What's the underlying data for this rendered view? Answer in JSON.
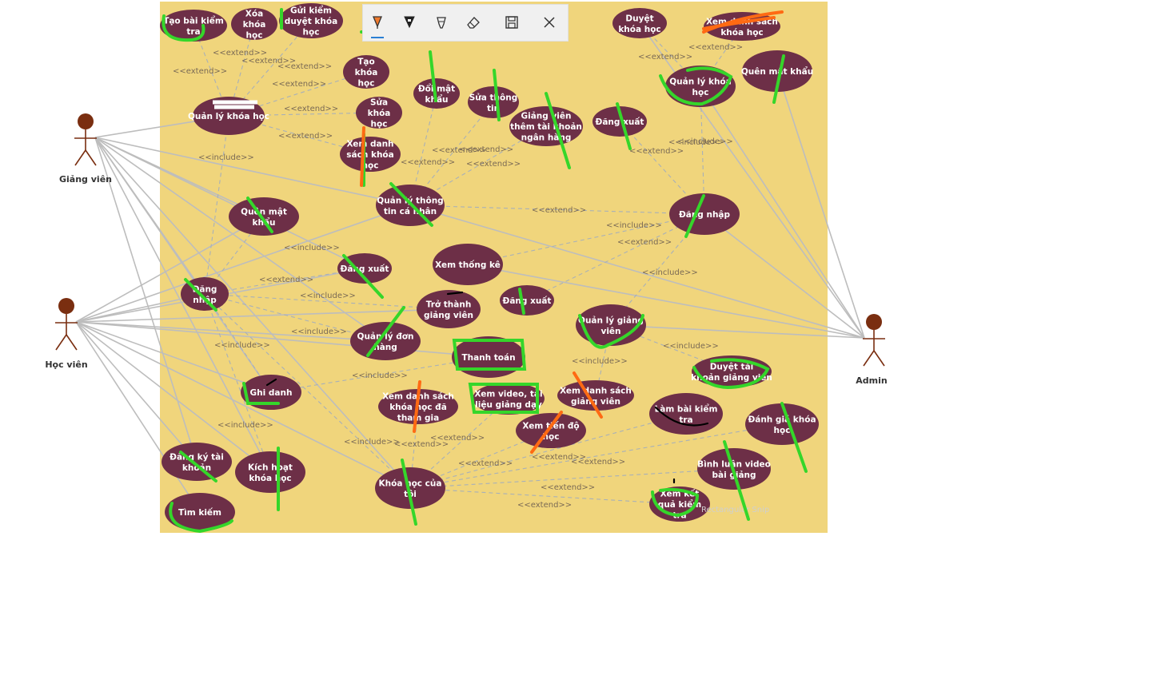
{
  "diagram": {
    "actors": [
      {
        "id": "lecturer",
        "label": "Giảng viên"
      },
      {
        "id": "student",
        "label": "Học viên"
      },
      {
        "id": "admin",
        "label": "Admin"
      }
    ],
    "use_cases": [
      {
        "id": "uc1",
        "lines": [
          "Tạo bài kiểm",
          "tra"
        ]
      },
      {
        "id": "uc2",
        "lines": [
          "Xóa",
          "khóa",
          "học"
        ]
      },
      {
        "id": "uc3",
        "lines": [
          "Gửi kiểm",
          "duyệt khóa",
          "học"
        ]
      },
      {
        "id": "uc4",
        "lines": [
          "Tạo",
          "khóa",
          "học"
        ]
      },
      {
        "id": "uc5",
        "lines": [
          "Quản lý khóa học"
        ]
      },
      {
        "id": "uc6",
        "lines": [
          "Sửa",
          "khóa",
          "học"
        ]
      },
      {
        "id": "uc7",
        "lines": [
          "Đổi mật",
          "khẩu"
        ]
      },
      {
        "id": "uc8",
        "lines": [
          "Sửa thông",
          "tin"
        ]
      },
      {
        "id": "uc9",
        "lines": [
          "Giảng viên",
          "thêm tài khoản",
          "ngân hàng"
        ]
      },
      {
        "id": "uc10",
        "lines": [
          "Đăng xuất"
        ]
      },
      {
        "id": "uc11",
        "lines": [
          "Xem danh",
          "sách khóa",
          "học"
        ]
      },
      {
        "id": "uc12",
        "lines": [
          "Duyệt",
          "khóa học"
        ]
      },
      {
        "id": "uc13",
        "lines": [
          "Xem danh sách",
          "khóa học"
        ]
      },
      {
        "id": "uc14",
        "lines": [
          "Quản lý khóa",
          "học"
        ]
      },
      {
        "id": "uc15",
        "lines": [
          "Quên mật khẩu"
        ]
      },
      {
        "id": "uc16",
        "lines": [
          "Quản lý thông",
          "tin cá nhân"
        ]
      },
      {
        "id": "uc17",
        "lines": [
          "Quên mật",
          "khẩu"
        ]
      },
      {
        "id": "uc18",
        "lines": [
          "Đăng nhập"
        ]
      },
      {
        "id": "uc19",
        "lines": [
          "Xem thống kê"
        ]
      },
      {
        "id": "uc20",
        "lines": [
          "Đăng xuất"
        ]
      },
      {
        "id": "uc21",
        "lines": [
          "Đăng",
          "nhập"
        ]
      },
      {
        "id": "uc22",
        "lines": [
          "Trở thành",
          "giảng viên"
        ]
      },
      {
        "id": "uc23",
        "lines": [
          "Đăng xuất"
        ]
      },
      {
        "id": "uc24",
        "lines": [
          "Quản lý giảng",
          "viên"
        ]
      },
      {
        "id": "uc25",
        "lines": [
          "Quản lý đơn",
          "hàng"
        ]
      },
      {
        "id": "uc26",
        "lines": [
          "Thanh toán"
        ]
      },
      {
        "id": "uc27",
        "lines": [
          "Duyệt tài",
          "khoản giảng viên"
        ]
      },
      {
        "id": "uc28",
        "lines": [
          "Ghi danh"
        ]
      },
      {
        "id": "uc29",
        "lines": [
          "Xem danh sách",
          "khóa học đã",
          "tham gia"
        ]
      },
      {
        "id": "uc30",
        "lines": [
          "Xem video, tài",
          "liệu giảng dạy"
        ]
      },
      {
        "id": "uc31",
        "lines": [
          "Xem danh sách",
          "giảng viên"
        ]
      },
      {
        "id": "uc32",
        "lines": [
          "Làm bài kiểm",
          "tra"
        ]
      },
      {
        "id": "uc33",
        "lines": [
          "Đánh giá khóa",
          "học"
        ]
      },
      {
        "id": "uc34",
        "lines": [
          "Xem tiến độ",
          "học"
        ]
      },
      {
        "id": "uc35",
        "lines": [
          "Đăng ký tài",
          "khoản"
        ]
      },
      {
        "id": "uc36",
        "lines": [
          "Kích hoạt",
          "khóa học"
        ]
      },
      {
        "id": "uc37",
        "lines": [
          "Bình luận video",
          "bài giảng"
        ]
      },
      {
        "id": "uc38",
        "lines": [
          "Khóa học của",
          "tôi"
        ]
      },
      {
        "id": "uc39",
        "lines": [
          "Xem kết",
          "quả kiểm",
          "tra"
        ]
      },
      {
        "id": "uc40",
        "lines": [
          "Tìm kiếm"
        ]
      }
    ],
    "relation_labels": [
      "<<extend>>",
      "<<extend>>",
      "<<extend>>",
      "<<extend>>",
      "<<extend>>",
      "<<extend>>",
      "<<extend>>",
      "<<extend>>",
      "<<extend>>",
      "<<extend>>",
      "<<extend>>",
      "<<extend>>",
      "<<extend>>",
      "<<include>>",
      "<<include>>",
      "<<extend>>",
      "<<include>>",
      "<<extend>>",
      "<<include>>",
      "<<extend>>",
      "<<include>>",
      "<<include>>",
      "<<include>>",
      "<<include>>",
      "<<include>>",
      "<<include>>",
      "<<include>>",
      "<<include>>",
      "<<include>>",
      "<<extend>>",
      "<<extend>>",
      "<<extend>>",
      "<<extend>>",
      "<<extend>>",
      "<<extend>>",
      "<<extend>>",
      "<<include>>",
      "<<extend>>"
    ],
    "watermark": "Rectangular Snip"
  },
  "snip_toolbar": {
    "tools": [
      {
        "name": "ballpoint-pen",
        "active": true
      },
      {
        "name": "pencil",
        "active": false
      },
      {
        "name": "highlighter",
        "active": false
      },
      {
        "name": "eraser",
        "active": false
      },
      {
        "name": "save",
        "active": false
      },
      {
        "name": "close",
        "active": false
      }
    ]
  },
  "colors": {
    "canvas": "#f0d57c",
    "use_case_fill": "#6d2f47",
    "use_case_text": "#ffffff",
    "actor": "#7a2e10",
    "association": "#bdbdbd",
    "dependency": "#a8b0b8",
    "annotation_green": "#35d62a",
    "annotation_orange": "#ff6a13",
    "annotation_black": "#000000",
    "toolbar_bg": "#f0f0f0",
    "toolbar_accent": "#2a7fd4"
  }
}
